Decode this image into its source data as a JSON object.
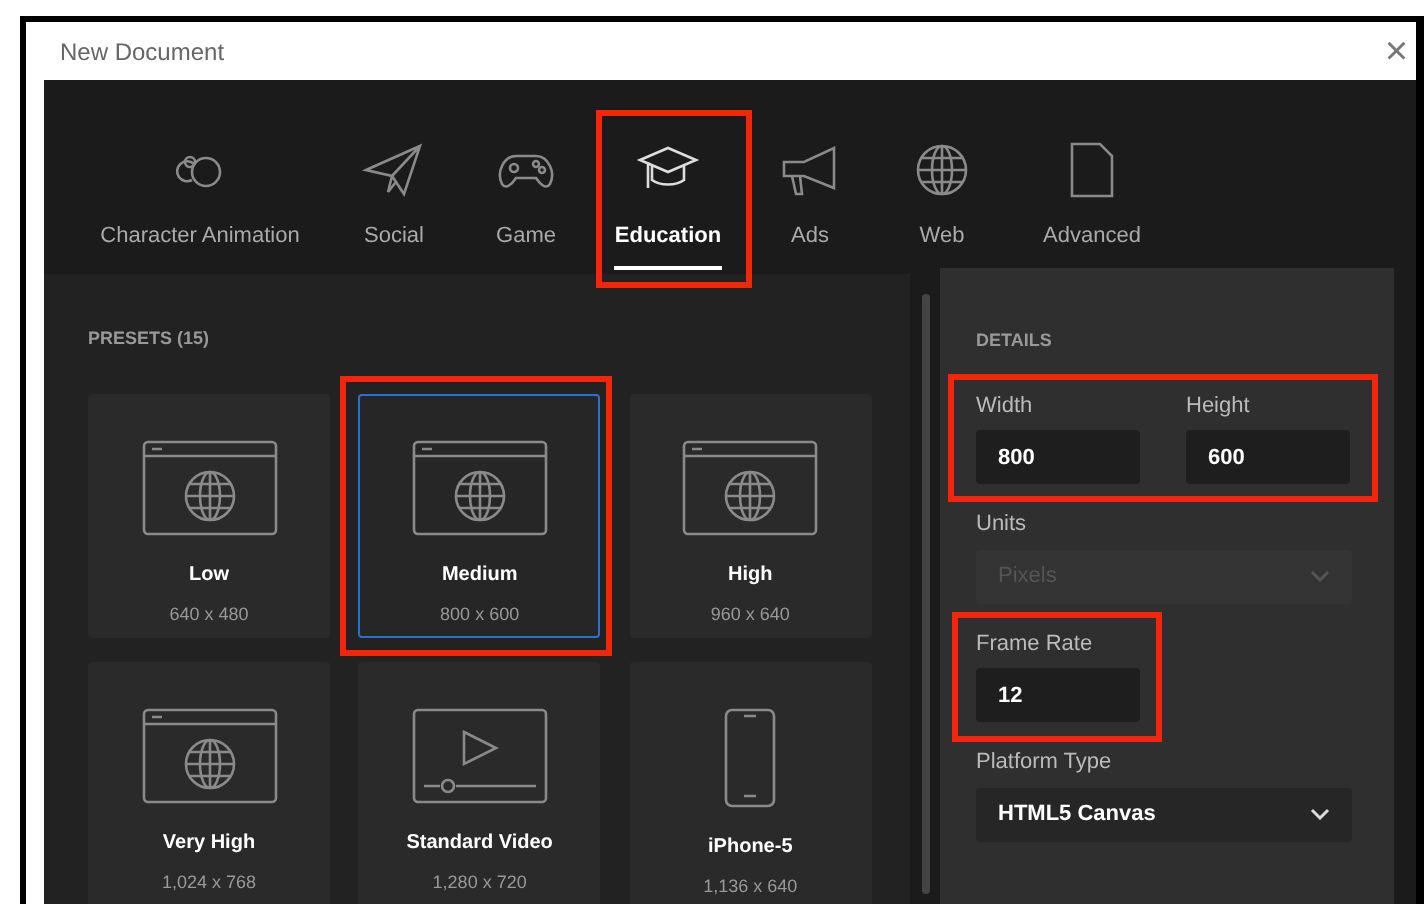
{
  "window": {
    "title": "New Document",
    "close": "×"
  },
  "tabs": [
    {
      "label": "Character Animation",
      "selected": false,
      "highlighted": false
    },
    {
      "label": "Social",
      "selected": false,
      "highlighted": false
    },
    {
      "label": "Game",
      "selected": false,
      "highlighted": false
    },
    {
      "label": "Education",
      "selected": true,
      "highlighted": true
    },
    {
      "label": "Ads",
      "selected": false,
      "highlighted": false
    },
    {
      "label": "Web",
      "selected": false,
      "highlighted": false
    },
    {
      "label": "Advanced",
      "selected": false,
      "highlighted": false
    }
  ],
  "presets": {
    "heading": "PRESETS (15)",
    "items": [
      {
        "name": "Low",
        "size": "640 x 480",
        "kind": "browser",
        "selected": false,
        "highlighted": false
      },
      {
        "name": "Medium",
        "size": "800 x 600",
        "kind": "browser",
        "selected": true,
        "highlighted": true
      },
      {
        "name": "High",
        "size": "960 x 640",
        "kind": "browser",
        "selected": false,
        "highlighted": false
      },
      {
        "name": "Very High",
        "size": "1,024 x 768",
        "kind": "browser",
        "selected": false,
        "highlighted": false
      },
      {
        "name": "Standard Video",
        "size": "1,280 x 720",
        "kind": "video",
        "selected": false,
        "highlighted": false
      },
      {
        "name": "iPhone-5",
        "size": "1,136 x 640",
        "kind": "phone",
        "selected": false,
        "highlighted": false
      }
    ]
  },
  "details": {
    "heading": "DETAILS",
    "size_group": {
      "highlighted": true,
      "fields": [
        {
          "label": "Width",
          "value": "800"
        },
        {
          "label": "Height",
          "value": "600"
        }
      ]
    },
    "units": {
      "label": "Units",
      "value": "Pixels",
      "disabled": true
    },
    "frame_rate": {
      "label": "Frame Rate",
      "value": "12",
      "highlighted": true
    },
    "platform_type": {
      "label": "Platform Type",
      "value": "HTML5 Canvas",
      "disabled": false
    }
  }
}
